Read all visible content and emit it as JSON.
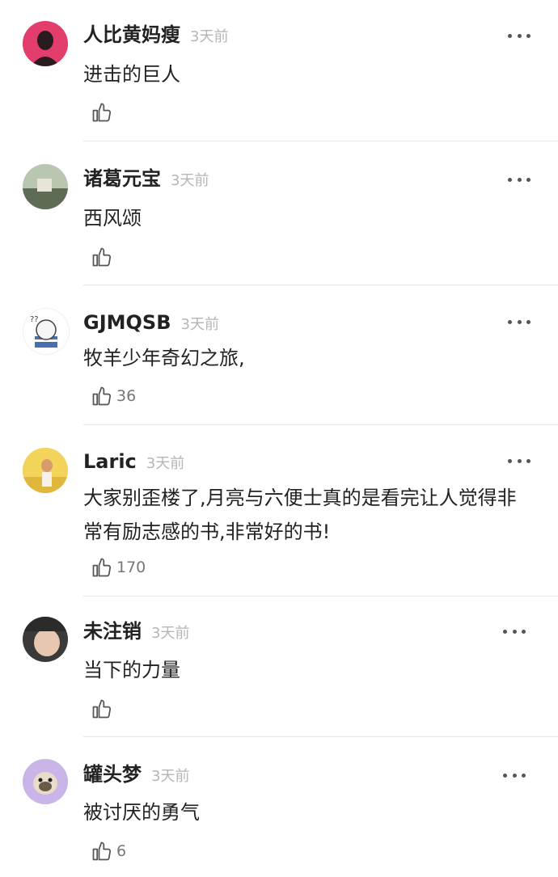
{
  "comments": [
    {
      "user": "人比黄妈瘦",
      "time": "3天前",
      "text": "进击的巨人",
      "likes": "",
      "avatar_colors": [
        "#e23d6b",
        "#2a1c1e"
      ]
    },
    {
      "user": "诸葛元宝",
      "time": "3天前",
      "text": "西风颂",
      "likes": "",
      "avatar_colors": [
        "#b9c7b1",
        "#5e6b55"
      ]
    },
    {
      "user": "GJMQSB",
      "time": "3天前",
      "text": "牧羊少年奇幻之旅,",
      "likes": "36",
      "avatar_colors": [
        "#ffffff",
        "#4a6fb0"
      ]
    },
    {
      "user": "Laric",
      "time": "3天前",
      "text": "大家别歪楼了,月亮与六便士真的是看完让人觉得非常有励志感的书,非常好的书!",
      "likes": "170",
      "avatar_colors": [
        "#f2d45a",
        "#d99a6c"
      ]
    },
    {
      "user": "未注销",
      "time": "3天前",
      "text": "当下的力量",
      "likes": "",
      "avatar_colors": [
        "#3a3a3a",
        "#e8c7b0"
      ]
    },
    {
      "user": "罐头梦",
      "time": "3天前",
      "text": "被讨厌的勇气",
      "likes": "6",
      "avatar_colors": [
        "#c9b5e8",
        "#6a5a48"
      ]
    }
  ]
}
